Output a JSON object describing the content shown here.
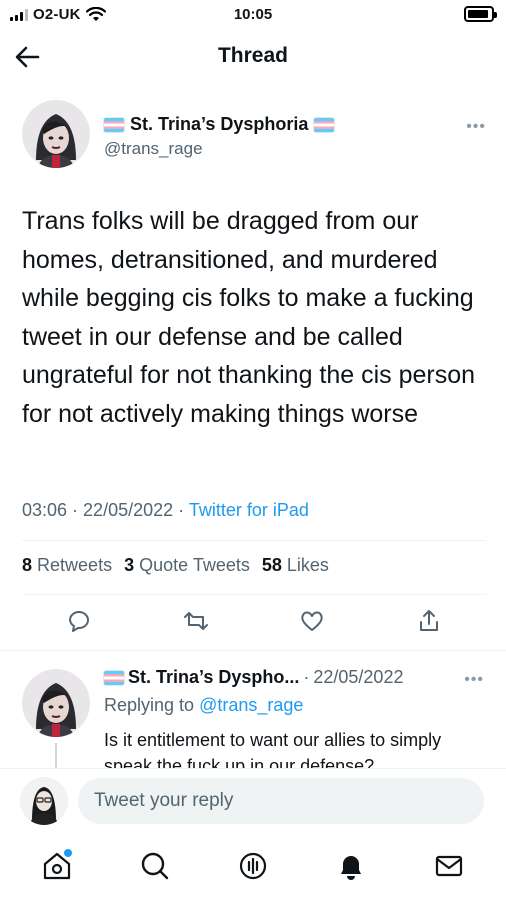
{
  "status_bar": {
    "carrier": "O2-UK",
    "time": "10:05",
    "battery_level": 0.9
  },
  "nav": {
    "title": "Thread"
  },
  "tweet": {
    "display_name": "St. Trina’s Dysphoria",
    "handle": "@trans_rage",
    "text": "Trans folks will be dragged from our homes, detransitioned, and murdered while begging cis folks to make a fucking tweet in our defense and be called ungrateful for not thanking the cis person for not actively making things worse",
    "time": "03:06",
    "date": "22/05/2022",
    "source": "Twitter for iPad",
    "stats": {
      "retweets_count": "8",
      "retweets_label": "Retweets",
      "quotes_count": "3",
      "quotes_label": "Quote Tweets",
      "likes_count": "58",
      "likes_label": "Likes"
    }
  },
  "reply": {
    "display_name": "St. Trina’s Dyspho...",
    "date": "22/05/2022",
    "replying_prefix": "Replying to",
    "replying_to": "@trans_rage",
    "text": "Is it entitlement to want our allies to simply speak the fuck up in our defense?"
  },
  "composer": {
    "placeholder": "Tweet your reply"
  },
  "colors": {
    "accent": "#1d9bf0",
    "secondary_text": "#536471",
    "flag_blue": "#5BCEFA",
    "flag_pink": "#F5A9B8"
  }
}
